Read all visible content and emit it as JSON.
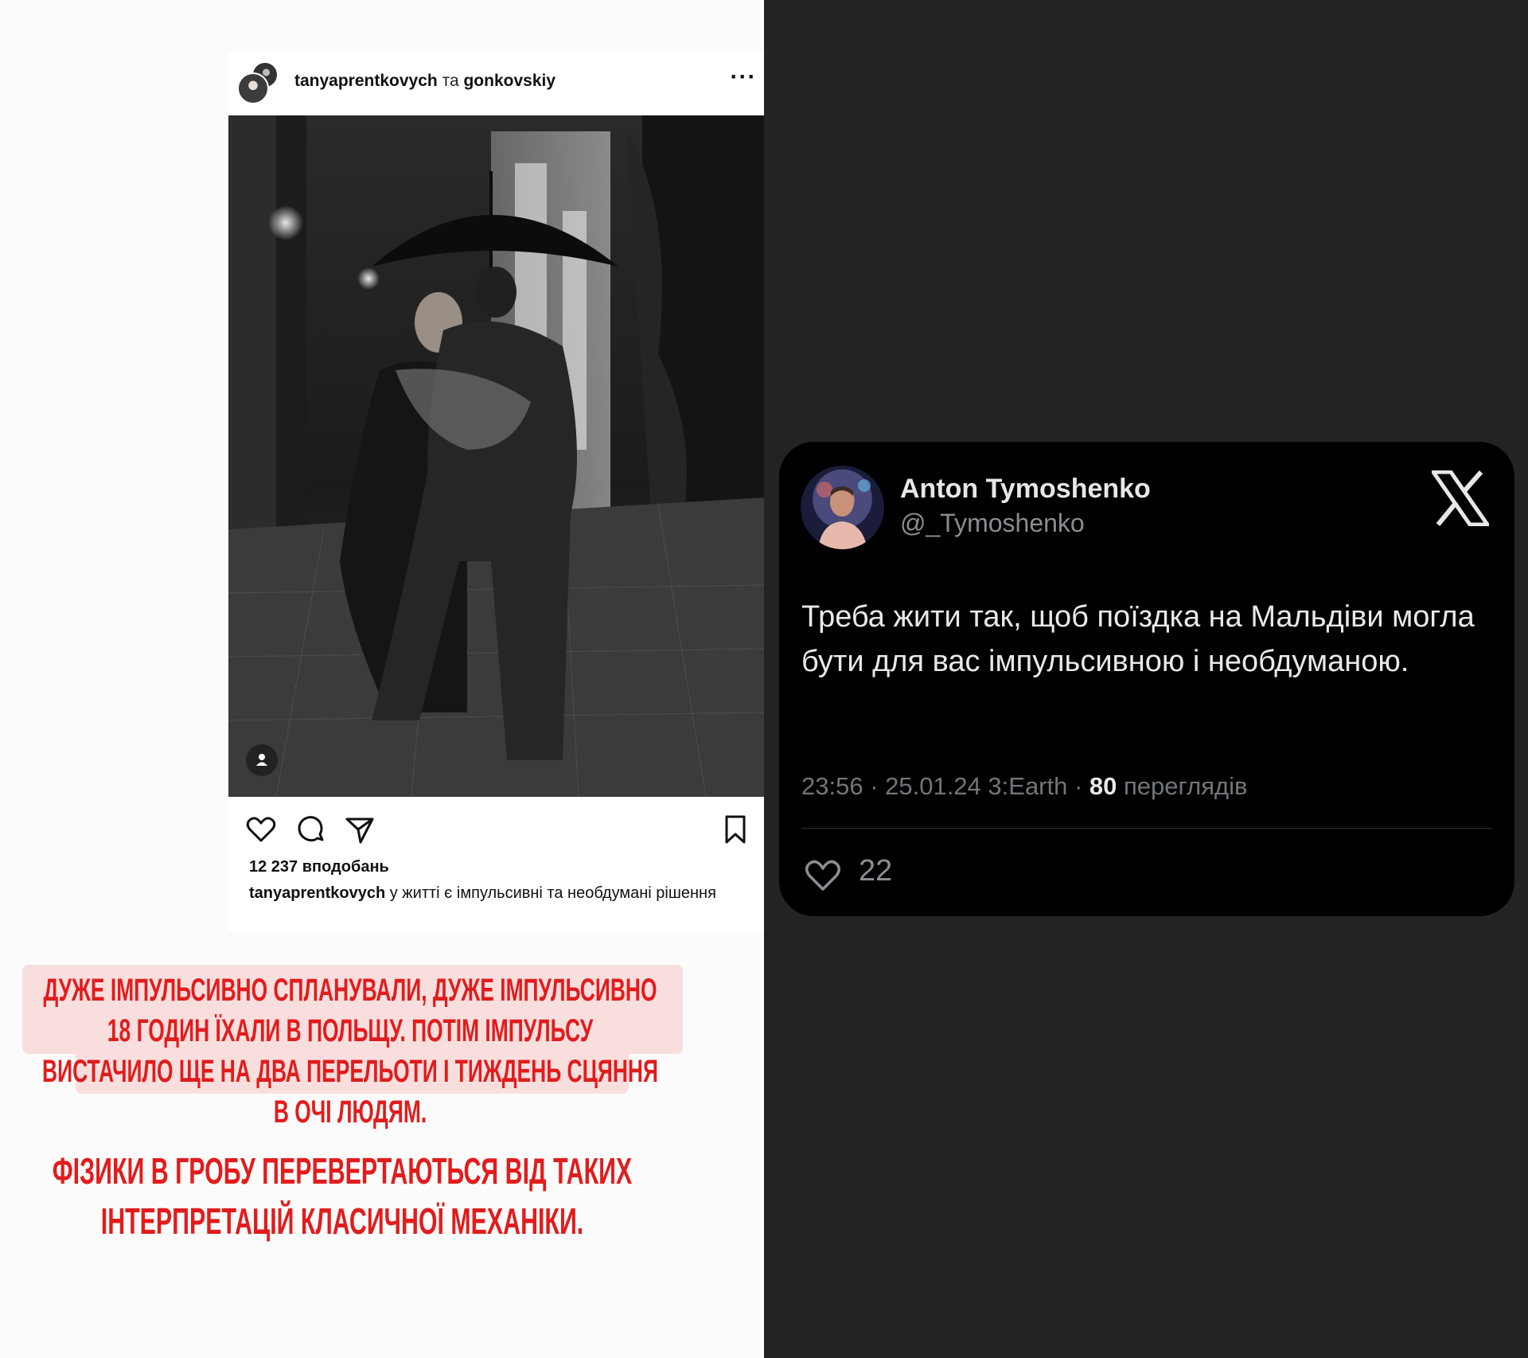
{
  "instagram": {
    "user1": "tanyaprentkovych",
    "conjunction": "та",
    "user2": "gonkovskiy",
    "more_icon": "more-dots-icon",
    "likes": "12 237 вподобань",
    "caption_user": "tanyaprentkovych",
    "caption_text": " у житті є імпульсивні та необдумані рішення"
  },
  "story_text": {
    "line1": "дуже імпульсивно спланували, дуже імпульсивно 18 годин їхали в польщу. потім імпульсу вистачило ще на два перельоти і тиждень сцяння в очі людям.",
    "line2": "фізики в гробу перевертаються від таких інтерпретацій класичної механіки."
  },
  "tweet": {
    "name": "Anton Tymoshenko",
    "handle": "@_Tymoshenko",
    "text": "Треба жити так, щоб поїздка на Мальдіви могла бути для вас імпульсивною і необдуманою.",
    "meta_prefix": "23:56 · 25.01.24 3:Earth · ",
    "views_count": "80",
    "views_label": " переглядів",
    "likes": "22"
  },
  "colors": {
    "story_red": "#e21c1c",
    "story_highlight": "#f9dede",
    "tweet_bg": "#000000",
    "page_dark": "#232323"
  }
}
